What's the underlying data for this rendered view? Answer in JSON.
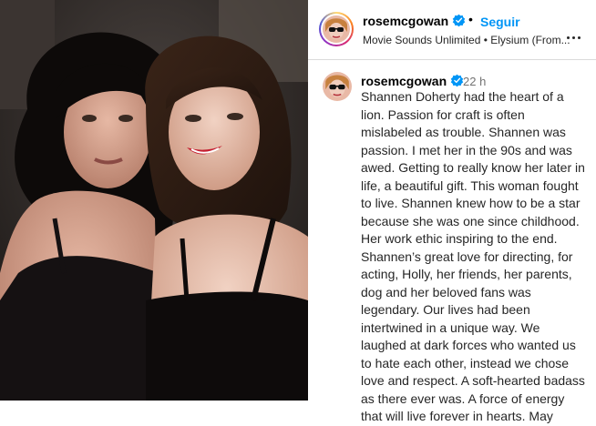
{
  "header": {
    "username": "rosemcgowan",
    "separator": "•",
    "follow_label": "Seguir",
    "subtitle": "Movie Sounds Unlimited • Elysium (From...",
    "verified_icon": "verified-badge-icon",
    "more_icon": "more-options-icon"
  },
  "comment": {
    "username": "rosemcgowan",
    "time": "22 h",
    "text": "Shannen Doherty had the heart of a lion. Passion for craft is often mislabeled as trouble. Shannen was passion. I met her in the 90s and was awed. Getting to really know her later in life, a beautiful gift. This woman fought to live. Shannen knew how to be a star because she was one since childhood. Her work ethic inspiring to the end. Shannen’s great love for directing, for acting, Holly, her friends, her parents, dog and her beloved fans was legendary. Our lives had been intertwined in a unique way. We laughed at dark forces who wanted us to hate each other, instead we chose love and respect. A soft-hearted badass as there ever was. A force of energy that will live forever in hearts. May"
  },
  "colors": {
    "follow_blue": "#0095f6",
    "verified_blue": "#0095f6",
    "muted_text": "#737373"
  }
}
